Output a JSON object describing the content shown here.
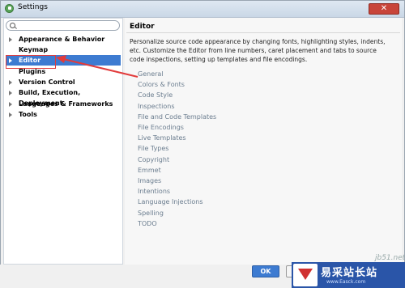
{
  "window": {
    "title": "Settings"
  },
  "search": {
    "placeholder": ""
  },
  "sidebar": {
    "items": [
      {
        "label": "Appearance & Behavior",
        "has_arrow": true
      },
      {
        "label": "Keymap",
        "has_arrow": false
      },
      {
        "label": "Editor",
        "has_arrow": true,
        "selected": true
      },
      {
        "label": "Plugins",
        "has_arrow": false
      },
      {
        "label": "Version Control",
        "has_arrow": true
      },
      {
        "label": "Build, Execution, Deployment",
        "has_arrow": true
      },
      {
        "label": "Languages & Frameworks",
        "has_arrow": true
      },
      {
        "label": "Tools",
        "has_arrow": true
      }
    ]
  },
  "main": {
    "title": "Editor",
    "description": "Personalize source code appearance by changing fonts, highlighting styles, indents, etc. Customize the Editor from line numbers, caret placement and tabs to source code inspections, setting up templates and file encodings.",
    "links": [
      "General",
      "Colors & Fonts",
      "Code Style",
      "Inspections",
      "File and Code Templates",
      "File Encodings",
      "Live Templates",
      "File Types",
      "Copyright",
      "Emmet",
      "Images",
      "Intentions",
      "Language Injections",
      "Spelling",
      "TODO"
    ]
  },
  "footer": {
    "ok_label": "OK"
  },
  "watermark": {
    "site": "jb51.net",
    "brand": "易采站长站",
    "url": "www.Easck.com"
  },
  "colors": {
    "accent": "#3d7bd1",
    "annotation": "#e23b3b"
  }
}
